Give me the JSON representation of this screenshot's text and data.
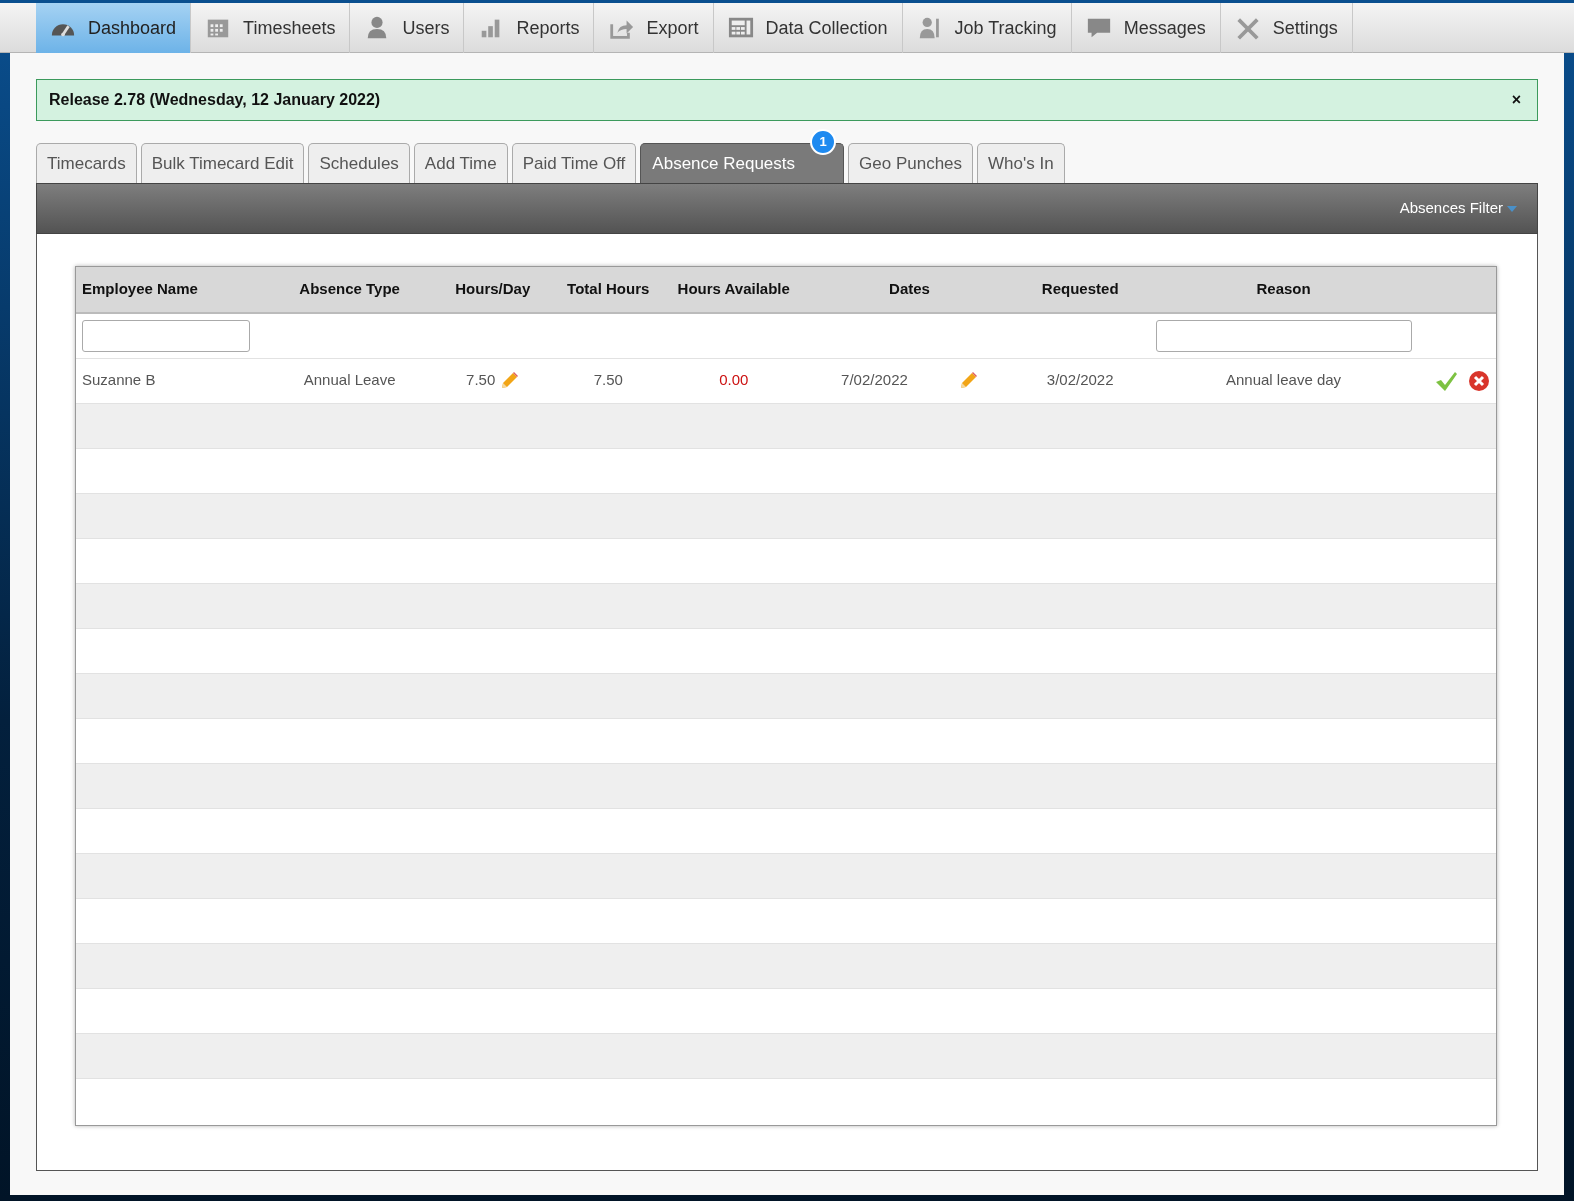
{
  "nav": [
    {
      "label": "Dashboard",
      "selected": true
    },
    {
      "label": "Timesheets",
      "selected": false
    },
    {
      "label": "Users",
      "selected": false
    },
    {
      "label": "Reports",
      "selected": false
    },
    {
      "label": "Export",
      "selected": false
    },
    {
      "label": "Data Collection",
      "selected": false
    },
    {
      "label": "Job Tracking",
      "selected": false
    },
    {
      "label": "Messages",
      "selected": false
    },
    {
      "label": "Settings",
      "selected": false
    }
  ],
  "alert": {
    "text": "Release 2.78 (Wednesday, 12 January 2022)",
    "close": "×"
  },
  "tabs": [
    {
      "label": "Timecards",
      "selected": false
    },
    {
      "label": "Bulk Timecard Edit",
      "selected": false
    },
    {
      "label": "Schedules",
      "selected": false
    },
    {
      "label": "Add Time",
      "selected": false
    },
    {
      "label": "Paid Time Off",
      "selected": false
    },
    {
      "label": "Absence Requests",
      "selected": true,
      "badge": "1"
    },
    {
      "label": "Geo Punches",
      "selected": false
    },
    {
      "label": "Who's In",
      "selected": false
    }
  ],
  "filter_menu": {
    "label": "Absences Filter"
  },
  "table": {
    "columns": [
      {
        "label": "Employee Name",
        "filter": true
      },
      {
        "label": "Absence Type",
        "filter": false
      },
      {
        "label": "Hours/Day",
        "filter": false
      },
      {
        "label": "Total Hours",
        "filter": false
      },
      {
        "label": "Hours Available",
        "filter": false
      },
      {
        "label": "Dates",
        "filter": false
      },
      {
        "label": "Requested",
        "filter": false
      },
      {
        "label": "Reason",
        "filter": true
      }
    ],
    "rows": [
      {
        "cells": [
          {
            "text": "Suzanne B"
          },
          {
            "text": "Annual Leave"
          },
          {
            "text": "7.50",
            "editable": true
          },
          {
            "text": "7.50"
          },
          {
            "text": "0.00",
            "warning": true
          },
          {
            "text": "7/02/2022",
            "editable": true
          },
          {
            "text": "3/02/2022"
          },
          {
            "text": "Annual leave day"
          }
        ]
      }
    ]
  }
}
